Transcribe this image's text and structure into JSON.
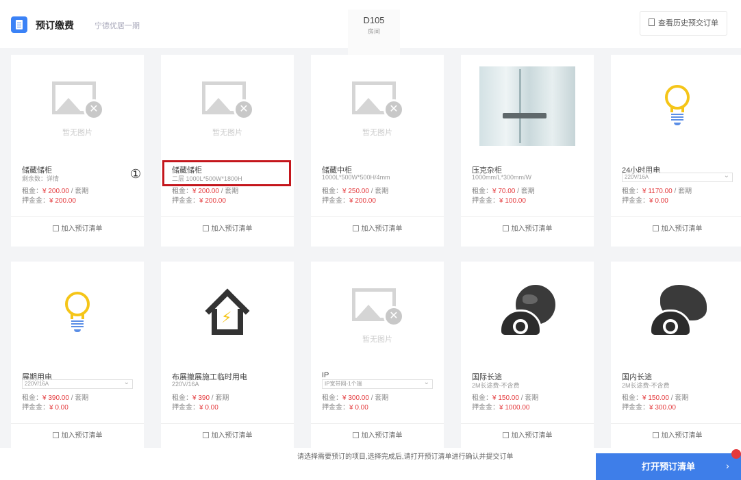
{
  "header": {
    "title": "预订缴费",
    "subtitle": "宁德优居一期",
    "room_number": "D105",
    "room_sub": "房间",
    "history_label": "查看历史预交订单"
  },
  "annotation": {
    "step": "①"
  },
  "products": [
    {
      "name": "储藏储柜",
      "spec": "剩余数：详情",
      "spec_is_select": false,
      "price_label": "租金：",
      "price": "¥ 200.00",
      "unit": " / 套期",
      "deposit_label": "押金金：",
      "deposit": "¥ 200.00",
      "add_label": "加入预订清单",
      "image": "placeholder"
    },
    {
      "name": "储藏储柜",
      "spec": "二层 1000L*500W*1800H",
      "spec_is_select": false,
      "price_label": "租金：",
      "price": "¥ 200.00",
      "unit": " / 套期",
      "deposit_label": "押金金：",
      "deposit": "¥ 200.00",
      "add_label": "加入预订清单",
      "image": "placeholder"
    },
    {
      "name": "储藏中柜",
      "spec": "1000L*500W*500H/4mm",
      "spec_is_select": false,
      "price_label": "租金：",
      "price": "¥ 250.00",
      "unit": " / 套期",
      "deposit_label": "押金金：",
      "deposit": "¥ 200.00",
      "add_label": "加入预订清单",
      "image": "placeholder"
    },
    {
      "name": "压克杂柜",
      "spec": "1000mm/L*300mm/W",
      "spec_is_select": false,
      "price_label": "租金：",
      "price": "¥ 70.00",
      "unit": " / 套期",
      "deposit_label": "押金金：",
      "deposit": "¥ 100.00",
      "add_label": "加入预订清单",
      "image": "photo"
    },
    {
      "name": "24小时用电",
      "spec": "220V/16A",
      "spec_is_select": true,
      "price_label": "租金：",
      "price": "¥ 1170.00",
      "unit": " / 套期",
      "deposit_label": "押金金：",
      "deposit": "¥ 0.00",
      "add_label": "加入预订清单",
      "image": "bulb"
    },
    {
      "name": "展期用电",
      "spec": "220V/16A",
      "spec_is_select": true,
      "price_label": "租金：",
      "price": "¥ 390.00",
      "unit": " / 套期",
      "deposit_label": "押金金：",
      "deposit": "¥ 0.00",
      "add_label": "加入预订清单",
      "image": "bulb"
    },
    {
      "name": "布展撤展施工临时用电",
      "spec": "220V/16A",
      "spec_is_select": false,
      "price_label": "租金：",
      "price": "¥ 390",
      "unit": " / 套期",
      "deposit_label": "押金金：",
      "deposit": "¥ 0.00",
      "add_label": "加入预订清单",
      "image": "house"
    },
    {
      "name": "IP",
      "spec": "IP宽带网-1个端",
      "spec_is_select": true,
      "price_label": "租金：",
      "price": "¥ 300.00",
      "unit": " / 套期",
      "deposit_label": "押金金：",
      "deposit": "¥ 0.00",
      "add_label": "加入预订清单",
      "image": "placeholder"
    },
    {
      "name": "国际长途",
      "spec": "2M长途费-不含费",
      "spec_is_select": false,
      "price_label": "租金：",
      "price": "¥ 150.00",
      "unit": " / 套期",
      "deposit_label": "押金金：",
      "deposit": "¥ 1000.00",
      "add_label": "加入预订清单",
      "image": "phone-globe"
    },
    {
      "name": "国内长途",
      "spec": "2M长途费-不含费",
      "spec_is_select": false,
      "price_label": "租金：",
      "price": "¥ 150.00",
      "unit": " / 套期",
      "deposit_label": "押金金：",
      "deposit": "¥ 300.00",
      "add_label": "加入预订清单",
      "image": "phone-china"
    }
  ],
  "placeholder_text": "暂无图片",
  "footer": {
    "hint": "请选择需要预订的项目,选择完成后,请打开预订清单进行确认并提交订单",
    "cart_label": "打开预订清单"
  }
}
